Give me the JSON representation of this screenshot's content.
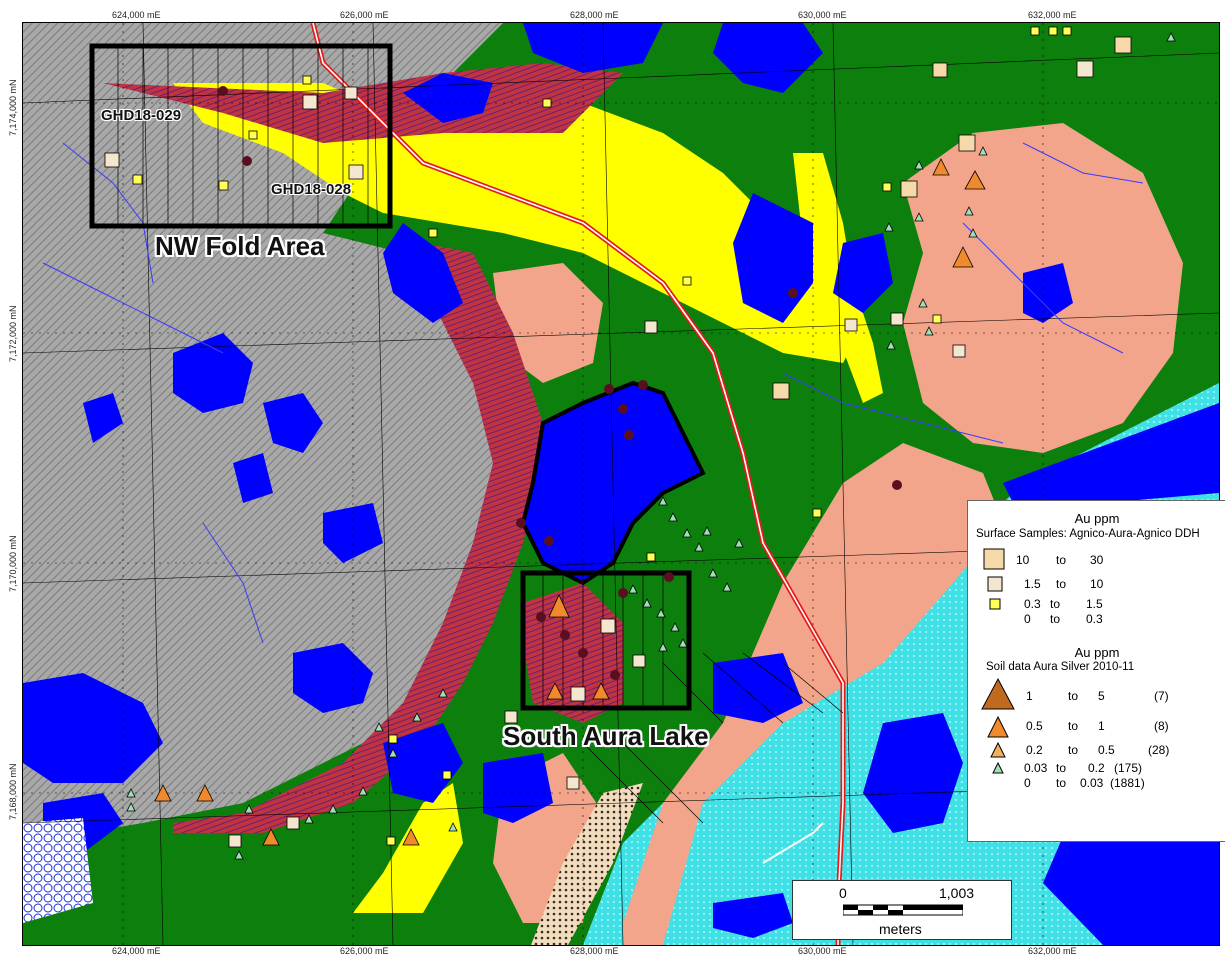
{
  "map": {
    "x_ticks": [
      "624,000 mE",
      "626,000 mE",
      "628,000 mE",
      "630,000 mE",
      "632,000 mE"
    ],
    "y_ticks": [
      "7,174,000 mN",
      "7,172,000 mN",
      "7,170,000 mN",
      "7,168,000 mN"
    ],
    "areas": {
      "nw_fold": "NW Fold Area",
      "south_aura": "South Aura Lake"
    },
    "drillholes": [
      "GHD18-029",
      "GHD18-028"
    ]
  },
  "legend": {
    "surface": {
      "title": "Au ppm",
      "subtitle": "Surface Samples: Agnico-Aura-Agnico DDH",
      "rows": [
        {
          "from": "10",
          "to": "to",
          "max": "30"
        },
        {
          "from": "1.5",
          "to": "to",
          "max": "10"
        },
        {
          "from": "0.3",
          "to": "to",
          "max": "1.5"
        },
        {
          "from": "0",
          "to": "to",
          "max": "0.3"
        }
      ]
    },
    "soil": {
      "title": "Au ppm",
      "subtitle": "Soil data Aura Silver 2010-11",
      "rows": [
        {
          "from": "1",
          "to": "to",
          "max": "5",
          "count": "(7)"
        },
        {
          "from": "0.5",
          "to": "to",
          "max": "1",
          "count": "(8)"
        },
        {
          "from": "0.2",
          "to": "to",
          "max": "0.5",
          "count": "(28)"
        },
        {
          "from": "0.03",
          "to": "to",
          "max": "0.2",
          "count": "(175)"
        },
        {
          "from": "0",
          "to": "to",
          "max": "0.03",
          "count": "(1881)"
        }
      ]
    }
  },
  "scalebar": {
    "start": "0",
    "end": "1,003",
    "unit": "meters"
  },
  "colors": {
    "grey": "#9a9a9a",
    "green": "#0d7f0d",
    "salmon": "#f3a58b",
    "yellow": "#ffff00",
    "water": "#0000ff",
    "cyan": "#3fd9e0",
    "red_hatch": "#c0343f",
    "square": "#f5d9a8",
    "triangle_orange": "#f08a2c",
    "triangle_green": "#9fe0b7"
  }
}
